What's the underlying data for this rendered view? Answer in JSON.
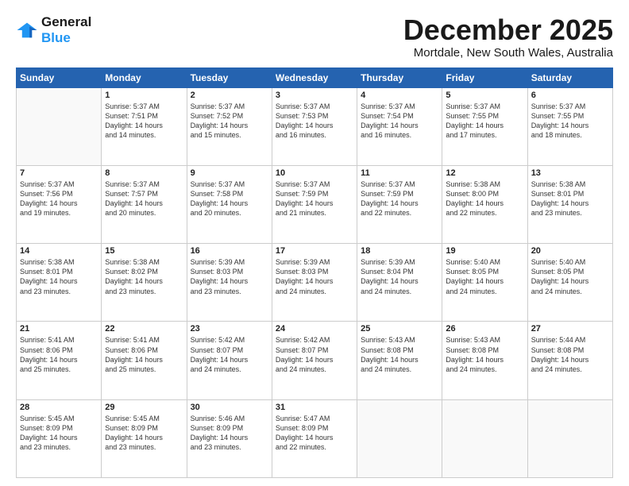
{
  "header": {
    "logo_line1": "General",
    "logo_line2": "Blue",
    "title": "December 2025",
    "location": "Mortdale, New South Wales, Australia"
  },
  "days_of_week": [
    "Sunday",
    "Monday",
    "Tuesday",
    "Wednesday",
    "Thursday",
    "Friday",
    "Saturday"
  ],
  "weeks": [
    [
      {
        "day": "",
        "text": ""
      },
      {
        "day": "1",
        "text": "Sunrise: 5:37 AM\nSunset: 7:51 PM\nDaylight: 14 hours\nand 14 minutes."
      },
      {
        "day": "2",
        "text": "Sunrise: 5:37 AM\nSunset: 7:52 PM\nDaylight: 14 hours\nand 15 minutes."
      },
      {
        "day": "3",
        "text": "Sunrise: 5:37 AM\nSunset: 7:53 PM\nDaylight: 14 hours\nand 16 minutes."
      },
      {
        "day": "4",
        "text": "Sunrise: 5:37 AM\nSunset: 7:54 PM\nDaylight: 14 hours\nand 16 minutes."
      },
      {
        "day": "5",
        "text": "Sunrise: 5:37 AM\nSunset: 7:55 PM\nDaylight: 14 hours\nand 17 minutes."
      },
      {
        "day": "6",
        "text": "Sunrise: 5:37 AM\nSunset: 7:55 PM\nDaylight: 14 hours\nand 18 minutes."
      }
    ],
    [
      {
        "day": "7",
        "text": "Sunrise: 5:37 AM\nSunset: 7:56 PM\nDaylight: 14 hours\nand 19 minutes."
      },
      {
        "day": "8",
        "text": "Sunrise: 5:37 AM\nSunset: 7:57 PM\nDaylight: 14 hours\nand 20 minutes."
      },
      {
        "day": "9",
        "text": "Sunrise: 5:37 AM\nSunset: 7:58 PM\nDaylight: 14 hours\nand 20 minutes."
      },
      {
        "day": "10",
        "text": "Sunrise: 5:37 AM\nSunset: 7:59 PM\nDaylight: 14 hours\nand 21 minutes."
      },
      {
        "day": "11",
        "text": "Sunrise: 5:37 AM\nSunset: 7:59 PM\nDaylight: 14 hours\nand 22 minutes."
      },
      {
        "day": "12",
        "text": "Sunrise: 5:38 AM\nSunset: 8:00 PM\nDaylight: 14 hours\nand 22 minutes."
      },
      {
        "day": "13",
        "text": "Sunrise: 5:38 AM\nSunset: 8:01 PM\nDaylight: 14 hours\nand 23 minutes."
      }
    ],
    [
      {
        "day": "14",
        "text": "Sunrise: 5:38 AM\nSunset: 8:01 PM\nDaylight: 14 hours\nand 23 minutes."
      },
      {
        "day": "15",
        "text": "Sunrise: 5:38 AM\nSunset: 8:02 PM\nDaylight: 14 hours\nand 23 minutes."
      },
      {
        "day": "16",
        "text": "Sunrise: 5:39 AM\nSunset: 8:03 PM\nDaylight: 14 hours\nand 23 minutes."
      },
      {
        "day": "17",
        "text": "Sunrise: 5:39 AM\nSunset: 8:03 PM\nDaylight: 14 hours\nand 24 minutes."
      },
      {
        "day": "18",
        "text": "Sunrise: 5:39 AM\nSunset: 8:04 PM\nDaylight: 14 hours\nand 24 minutes."
      },
      {
        "day": "19",
        "text": "Sunrise: 5:40 AM\nSunset: 8:05 PM\nDaylight: 14 hours\nand 24 minutes."
      },
      {
        "day": "20",
        "text": "Sunrise: 5:40 AM\nSunset: 8:05 PM\nDaylight: 14 hours\nand 24 minutes."
      }
    ],
    [
      {
        "day": "21",
        "text": "Sunrise: 5:41 AM\nSunset: 8:06 PM\nDaylight: 14 hours\nand 25 minutes."
      },
      {
        "day": "22",
        "text": "Sunrise: 5:41 AM\nSunset: 8:06 PM\nDaylight: 14 hours\nand 25 minutes."
      },
      {
        "day": "23",
        "text": "Sunrise: 5:42 AM\nSunset: 8:07 PM\nDaylight: 14 hours\nand 24 minutes."
      },
      {
        "day": "24",
        "text": "Sunrise: 5:42 AM\nSunset: 8:07 PM\nDaylight: 14 hours\nand 24 minutes."
      },
      {
        "day": "25",
        "text": "Sunrise: 5:43 AM\nSunset: 8:08 PM\nDaylight: 14 hours\nand 24 minutes."
      },
      {
        "day": "26",
        "text": "Sunrise: 5:43 AM\nSunset: 8:08 PM\nDaylight: 14 hours\nand 24 minutes."
      },
      {
        "day": "27",
        "text": "Sunrise: 5:44 AM\nSunset: 8:08 PM\nDaylight: 14 hours\nand 24 minutes."
      }
    ],
    [
      {
        "day": "28",
        "text": "Sunrise: 5:45 AM\nSunset: 8:09 PM\nDaylight: 14 hours\nand 23 minutes."
      },
      {
        "day": "29",
        "text": "Sunrise: 5:45 AM\nSunset: 8:09 PM\nDaylight: 14 hours\nand 23 minutes."
      },
      {
        "day": "30",
        "text": "Sunrise: 5:46 AM\nSunset: 8:09 PM\nDaylight: 14 hours\nand 23 minutes."
      },
      {
        "day": "31",
        "text": "Sunrise: 5:47 AM\nSunset: 8:09 PM\nDaylight: 14 hours\nand 22 minutes."
      },
      {
        "day": "",
        "text": ""
      },
      {
        "day": "",
        "text": ""
      },
      {
        "day": "",
        "text": ""
      }
    ]
  ]
}
